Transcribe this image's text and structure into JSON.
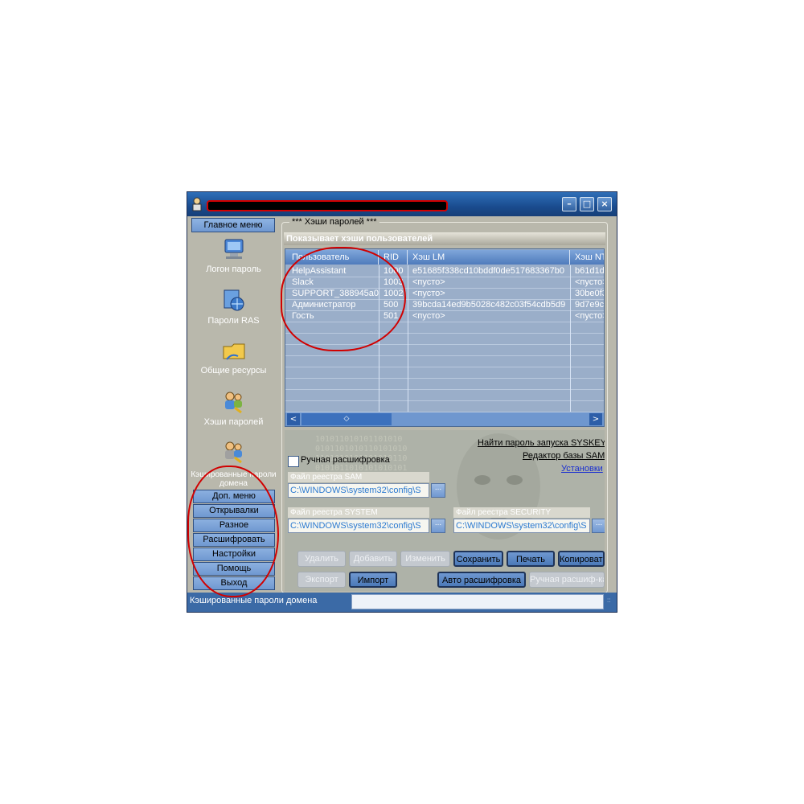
{
  "window": {
    "title": "",
    "controls": {
      "minimize": "–",
      "maximize": "□",
      "close": "×"
    }
  },
  "sidebar": {
    "header": "Главное меню",
    "items": [
      {
        "label": "Логон пароль",
        "icon": "computer-key-icon"
      },
      {
        "label": "Пароли RAS",
        "icon": "network-globe-icon"
      },
      {
        "label": "Общие ресурсы",
        "icon": "shared-folder-icon"
      },
      {
        "label": "Хэши паролей",
        "icon": "users-key-icon"
      },
      {
        "label": "Кэшированные пароли домена",
        "icon": "users-key-icon"
      }
    ],
    "menu_buttons": [
      "Доп. меню",
      "Открывалки",
      "Разное",
      "Расшифровать PWL",
      "Настройки",
      "Помощь",
      "Выход"
    ]
  },
  "group": {
    "legend": "*** Хэши паролей ***",
    "header_bar": "Показывает хэши пользователей",
    "columns": [
      "Пользователь",
      "RID",
      "Хэш LM",
      "Хэш NT"
    ],
    "rows": [
      [
        "HelpAssistant",
        "1000",
        "e51685f338cd10bddf0de517683367b0",
        "b61d1d"
      ],
      [
        "Slack",
        "1003",
        "<пусто>",
        "<пусто>"
      ],
      [
        "SUPPORT_388945a0",
        "1002",
        "<пусто>",
        "30be0f3"
      ],
      [
        "Администратор",
        "500",
        "39bcda14ed9b5028c482c03f54cdb5d9",
        "9d7e9cf"
      ],
      [
        "Гость",
        "501",
        "<пусто>",
        "<пусто>"
      ]
    ],
    "scroll": {
      "left": "<",
      "thumb": "◇",
      "right": ">"
    }
  },
  "lower": {
    "binary_bg": "101011010101101010\n0101101010110101010\n1101010101101010110\n0101011010101010101",
    "link_syskey": "Найти пароль запуска SYSKEY",
    "link_sam_editor": "Редактор базы SAM",
    "link_settings": "Установки",
    "manual_decrypt_label": "Ручная расшифровка",
    "sam_file": {
      "label": "Файл реестра SAM",
      "value": "C:\\WINDOWS\\system32\\config\\S"
    },
    "system_file": {
      "label": "Файл реестра SYSTEM",
      "value": "C:\\WINDOWS\\system32\\config\\S"
    },
    "security_file": {
      "label": "Файл реестра SECURITY",
      "value": "C:\\WINDOWS\\system32\\config\\S"
    },
    "browse": "...",
    "buttons_row1": [
      {
        "label": "Удалить",
        "enabled": false
      },
      {
        "label": "Добавить",
        "enabled": false
      },
      {
        "label": "Изменить",
        "enabled": false
      },
      {
        "label": "Сохранить",
        "enabled": true
      },
      {
        "label": "Печать",
        "enabled": true
      },
      {
        "label": "Копировать",
        "enabled": true
      }
    ],
    "buttons_row2": [
      {
        "label": "Экспорт",
        "enabled": false
      },
      {
        "label": "Импорт",
        "enabled": true
      },
      {
        "label": "Авто расшифровка",
        "enabled": true
      },
      {
        "label": "Ручная расшиф-ка",
        "enabled": false
      }
    ]
  },
  "statusbar": {
    "text": "Кэшированные пароли домена",
    "grip": "::"
  },
  "colors": {
    "annotation": "#d10000",
    "titlebar": "#1a4c8f",
    "accent": "#6f98d1"
  }
}
